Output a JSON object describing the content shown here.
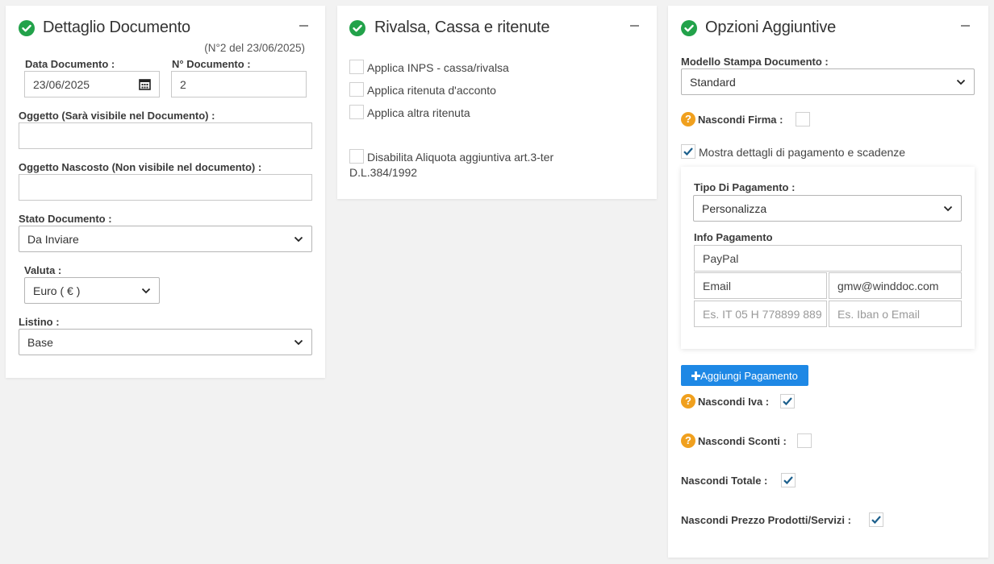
{
  "panel1": {
    "title": "Dettaglio Documento",
    "subtitle": "(N°2 del 23/06/2025)",
    "data_label": "Data Documento :",
    "data_value": "23/06/2025",
    "numero_label": "N° Documento :",
    "numero_value": "2",
    "oggetto_label": "Oggetto (Sarà visibile nel Documento) :",
    "oggetto_value": "",
    "nascosto_label": "Oggetto Nascosto (Non visibile nel documento) :",
    "nascosto_value": "",
    "stato_label": "Stato Documento :",
    "stato_value": "Da Inviare",
    "valuta_label": "Valuta :",
    "valuta_value": "Euro ( € )",
    "listino_label": "Listino :",
    "listino_value": "Base"
  },
  "panel2": {
    "title": "Rivalsa, Cassa e ritenute",
    "opt_inps": "Applica INPS - cassa/rivalsa",
    "opt_ritenuta": "Applica ritenuta d'acconto",
    "opt_altra": "Applica altra ritenuta",
    "opt_disabilita_line1": "Disabilita Aliquota aggiuntiva art.3-ter",
    "opt_disabilita_line2": "D.L.384/1992"
  },
  "panel3": {
    "title": "Opzioni Aggiuntive",
    "modello_label": "Modello Stampa Documento :",
    "modello_value": "Standard",
    "nascondi_firma": "Nascondi Firma :",
    "mostra_dettagli": "Mostra dettagli di pagamento e scadenze",
    "tipo_label": "Tipo Di Pagamento :",
    "tipo_value": "Personalizza",
    "info_label": "Info Pagamento",
    "info_value": "PayPal",
    "email_label_value": "Email",
    "email_value": "gmw@winddoc.com",
    "iban_placeholder": "Es. IT 05 H 778899 889",
    "iban_email_placeholder": "Es. Iban o Email",
    "add_button": "Aggiungi Pagamento",
    "nascondi_iva": "Nascondi Iva :",
    "nascondi_sconti": "Nascondi Sconti :",
    "nascondi_totale": "Nascondi Totale :",
    "nascondi_prezzo": "Nascondi Prezzo Prodotti/Servizi :"
  },
  "colors": {
    "green": "#22a24a",
    "orange": "#f0a01e",
    "blue": "#1e88e5",
    "check": "#1c5f8c"
  },
  "icons": [
    "check-circle-icon",
    "minus-icon",
    "calendar-icon",
    "chevron-down-icon",
    "question-icon",
    "checkmark-icon",
    "plus-icon"
  ]
}
